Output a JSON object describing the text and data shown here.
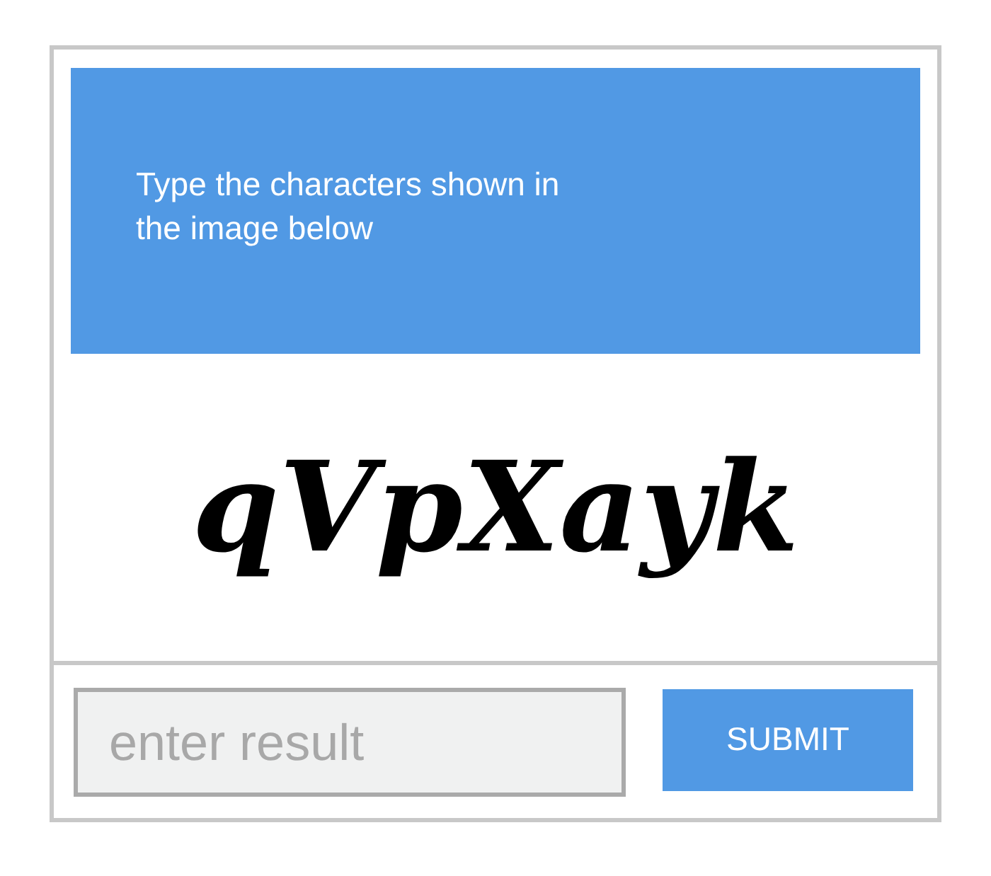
{
  "prompt": {
    "text": "Type the characters shown in the image below"
  },
  "captcha": {
    "text": "qVpXayk"
  },
  "answer": {
    "placeholder": "enter result"
  },
  "submit": {
    "label": "SUBMIT"
  }
}
